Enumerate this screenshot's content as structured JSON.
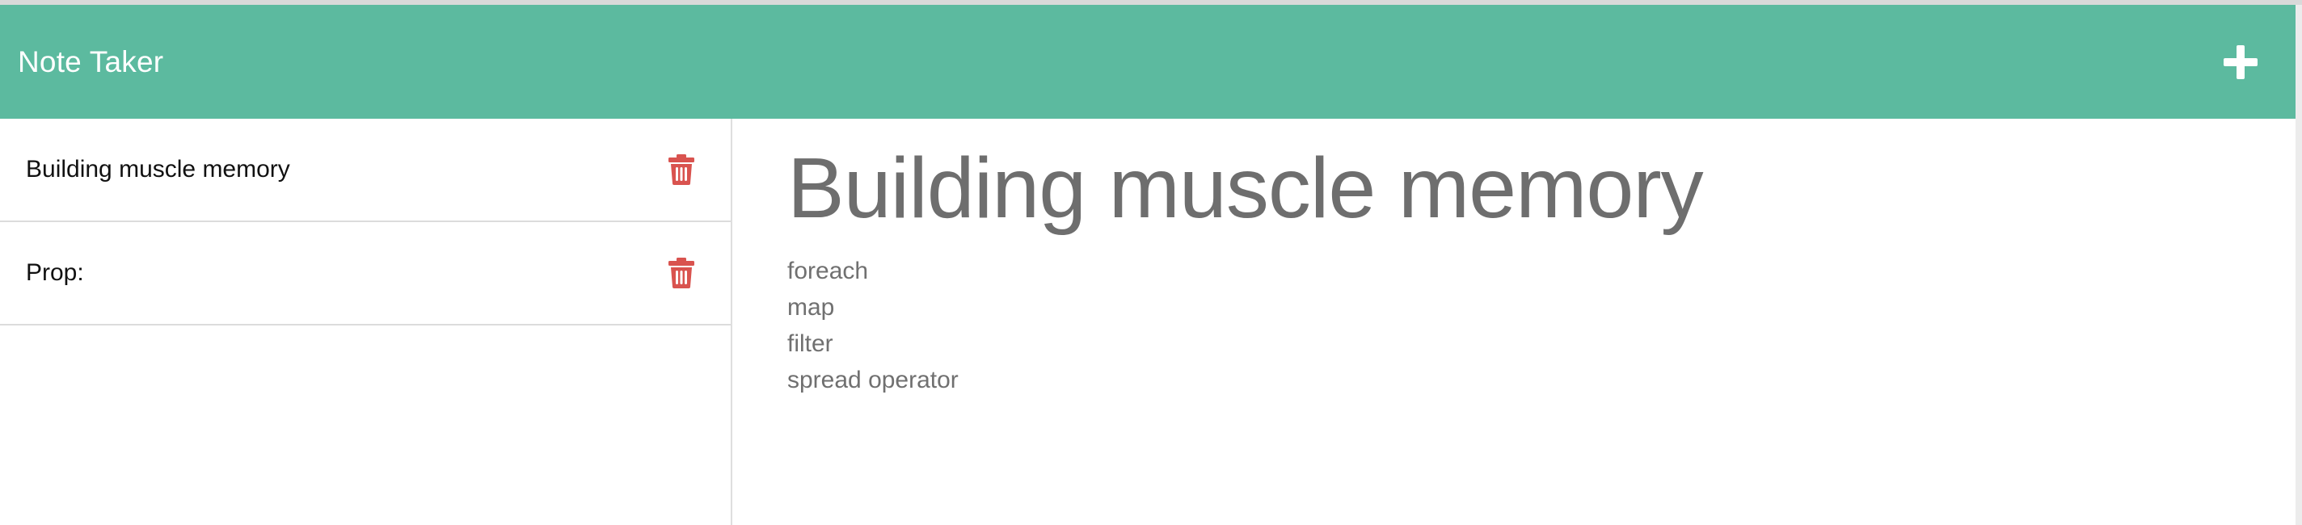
{
  "app": {
    "title": "Note Taker"
  },
  "colors": {
    "navbar": "#5cba9f",
    "delete_icon": "#d9534f",
    "title_text": "#6e6e6e"
  },
  "navbar": {
    "add_icon": "plus-icon"
  },
  "notes": [
    {
      "title": "Building muscle memory",
      "icon": "trash-icon"
    },
    {
      "title": "Prop:",
      "icon": "trash-icon"
    }
  ],
  "active_note": {
    "title": "Building muscle memory",
    "lines": [
      "foreach",
      "map",
      "filter",
      "spread operator"
    ]
  }
}
